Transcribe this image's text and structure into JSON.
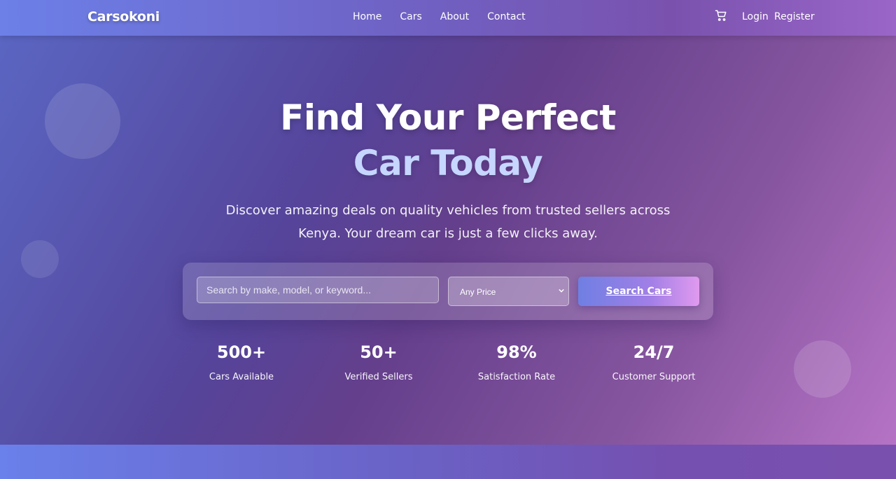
{
  "nav": {
    "brand": "Carsokoni",
    "links": [
      "Home",
      "Cars",
      "About",
      "Contact"
    ],
    "cart_icon": "cart-icon",
    "login": "Login",
    "register": "Register"
  },
  "hero": {
    "title_line1": "Find Your Perfect",
    "title_line2": "Car Today",
    "subtitle": "Discover amazing deals on quality vehicles from trusted sellers across Kenya. Your dream car is just a few clicks away.",
    "search": {
      "placeholder": "Search by make, model, or keyword...",
      "price_selected": "Any Price",
      "button": "Search Cars"
    },
    "stats": [
      {
        "value": "500+",
        "label": "Cars Available"
      },
      {
        "value": "50+",
        "label": "Verified Sellers"
      },
      {
        "value": "98%",
        "label": "Satisfaction Rate"
      },
      {
        "value": "24/7",
        "label": "Customer Support"
      }
    ]
  },
  "colors": {
    "accent": "#c6d6ff",
    "brand_start": "#6c80e8",
    "brand_end": "#9a66c8"
  }
}
